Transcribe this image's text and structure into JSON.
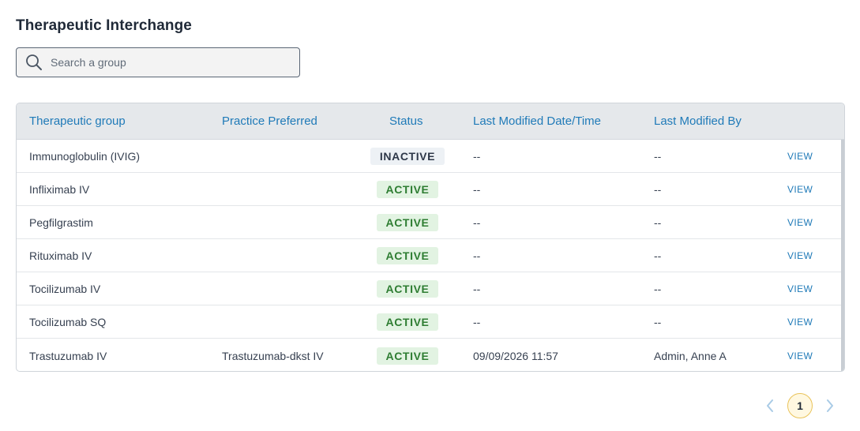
{
  "page": {
    "title": "Therapeutic Interchange"
  },
  "search": {
    "placeholder": "Search a group",
    "value": ""
  },
  "table": {
    "headers": {
      "group": "Therapeutic group",
      "preferred": "Practice Preferred",
      "status": "Status",
      "modified_date": "Last Modified Date/Time",
      "modified_by": "Last Modified By"
    },
    "view_label": "VIEW",
    "rows": [
      {
        "group": "Immunoglobulin (IVIG)",
        "preferred": "",
        "status": "INACTIVE",
        "modified_date": "--",
        "modified_by": "--"
      },
      {
        "group": "Infliximab IV",
        "preferred": "",
        "status": "ACTIVE",
        "modified_date": "--",
        "modified_by": "--"
      },
      {
        "group": "Pegfilgrastim",
        "preferred": "",
        "status": "ACTIVE",
        "modified_date": "--",
        "modified_by": "--"
      },
      {
        "group": "Rituximab IV",
        "preferred": "",
        "status": "ACTIVE",
        "modified_date": "--",
        "modified_by": "--"
      },
      {
        "group": "Tocilizumab IV",
        "preferred": "",
        "status": "ACTIVE",
        "modified_date": "--",
        "modified_by": "--"
      },
      {
        "group": "Tocilizumab SQ",
        "preferred": "",
        "status": "ACTIVE",
        "modified_date": "--",
        "modified_by": "--"
      },
      {
        "group": "Trastuzumab IV",
        "preferred": "Trastuzumab-dkst IV",
        "status": "ACTIVE",
        "modified_date": "09/09/2026 11:57",
        "modified_by": "Admin, Anne A"
      }
    ]
  },
  "pagination": {
    "current_page": "1"
  },
  "colors": {
    "accent": "#1f7ab8",
    "active_bg": "#e2f3e2",
    "active_text": "#2e7d32",
    "page_highlight": "#e9c35a"
  },
  "icons": {
    "search": "search-icon",
    "prev": "chevron-left-icon",
    "next": "chevron-right-icon"
  }
}
